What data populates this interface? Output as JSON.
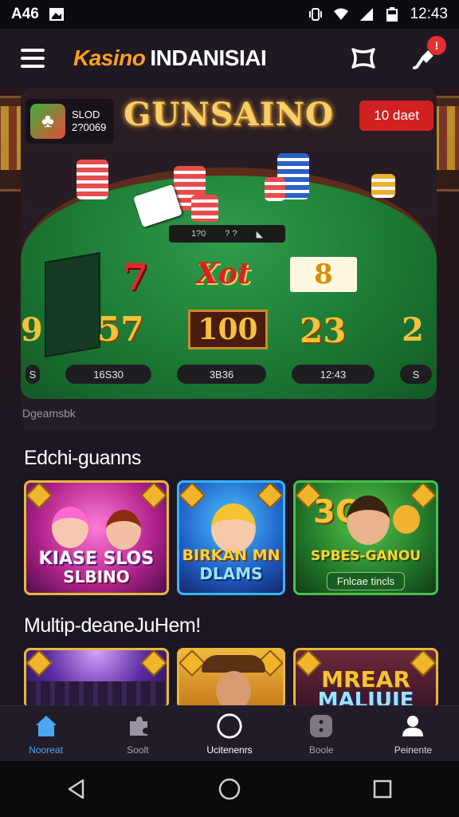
{
  "status_bar": {
    "left_text": "A46",
    "time": "12:43",
    "icons": [
      "image-icon",
      "vibrate-icon",
      "wifi-icon",
      "signal-icon",
      "battery-icon"
    ]
  },
  "header": {
    "brand_accent": "Kasino",
    "brand_rest": "INDANISIAI",
    "menu_icon": "hamburger-menu-icon",
    "action_icons": [
      "diamond-icon",
      "notification-bell-icon"
    ],
    "notification_badge": "!",
    "colors": {
      "accent": "#ffa021",
      "badge": "#e53030"
    }
  },
  "hero": {
    "sign": "GUNSAINO",
    "promo": {
      "line1": "SLOD",
      "line2": "2?0069",
      "icon": "clover-badge-icon"
    },
    "badge_button": "10 daet",
    "timer_left": "1?0",
    "timer_right": "? ?",
    "symbols": {
      "seven": "7",
      "xot": "Xot",
      "eight": "8",
      "fifty_seven": "57",
      "hundred": "100",
      "twenty_three": "23",
      "left_partial": "9",
      "right_partial": "2"
    },
    "stats": [
      "S",
      "16S30",
      "3B36",
      "12:43",
      "S"
    ],
    "caption": "Dgeamsbk"
  },
  "sections": [
    {
      "title": "Edchi-guanns",
      "games": [
        {
          "title_line1": "KIASE SLOS",
          "title_line2": "SLBINO"
        },
        {
          "title_line1": "BIRKAN MN",
          "title_line2": "DLAMS"
        },
        {
          "title_line1": "3O",
          "title_line2": "SPBES-GANOU",
          "subtitle": "Fnlcae tincls"
        }
      ]
    },
    {
      "title": "Multip-deaneJuHem!",
      "games": [
        {
          "title_line1": ""
        },
        {
          "title_line1": ""
        },
        {
          "title_line1": "MREAR",
          "title_line2": "MALIUIE"
        }
      ]
    }
  ],
  "bottom_nav": [
    {
      "label": "Nooreat",
      "icon": "home-icon",
      "active": true
    },
    {
      "label": "Soolt",
      "icon": "puzzle-icon",
      "active": false
    },
    {
      "label": "Ucitenenrs",
      "icon": "circle-icon",
      "active": false
    },
    {
      "label": "Boole",
      "icon": "dice-icon",
      "active": false
    },
    {
      "label": "Peinente",
      "icon": "profile-icon",
      "active": false
    }
  ],
  "system_nav": [
    "back-icon",
    "home-circle-icon",
    "recents-icon"
  ]
}
